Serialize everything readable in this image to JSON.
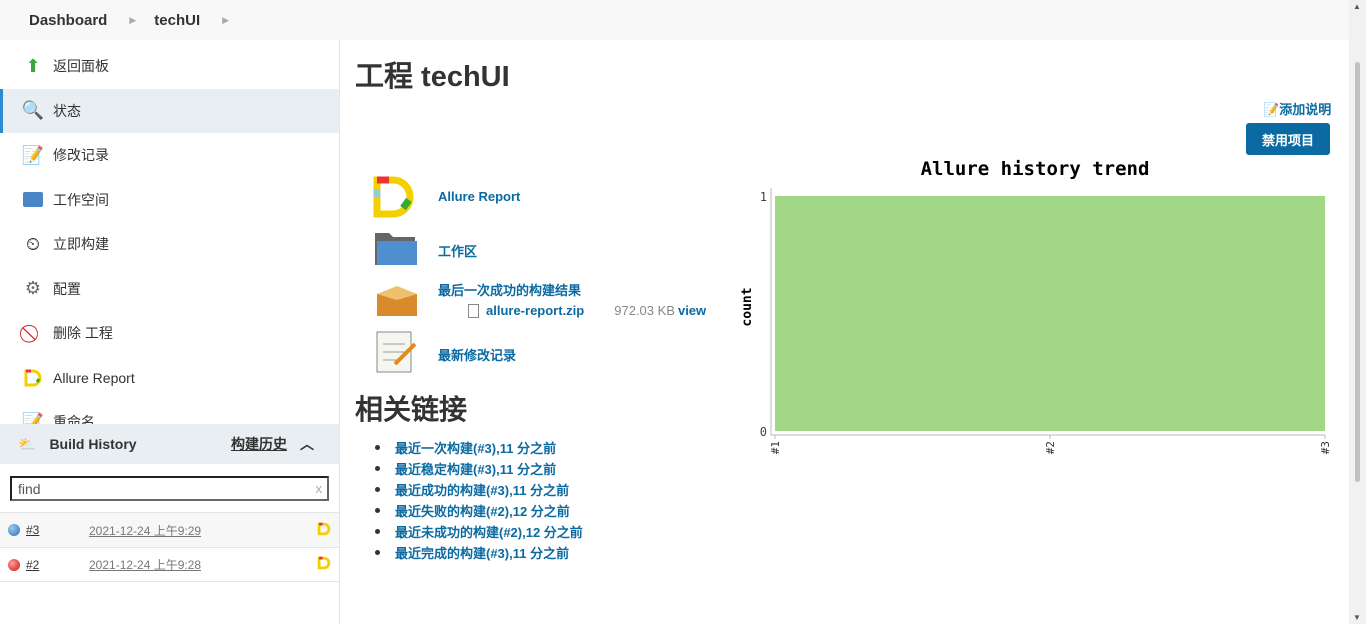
{
  "breadcrumb": [
    "Dashboard",
    "techUI"
  ],
  "sidebar": {
    "items": [
      {
        "label": "返回面板",
        "icon": "up-arrow-icon"
      },
      {
        "label": "状态",
        "icon": "search-icon",
        "active": true
      },
      {
        "label": "修改记录",
        "icon": "notepad-icon"
      },
      {
        "label": "工作空间",
        "icon": "folder-icon"
      },
      {
        "label": "立即构建",
        "icon": "clock-build-icon"
      },
      {
        "label": "配置",
        "icon": "gear-icon"
      },
      {
        "label": "删除 工程",
        "icon": "no-entry-icon"
      },
      {
        "label": "Allure Report",
        "icon": "allure-icon"
      },
      {
        "label": "重命名",
        "icon": "notepad-icon"
      }
    ]
  },
  "build_history": {
    "title": "Build History",
    "trend_label": "构建历史",
    "search_placeholder": "find",
    "clear": "x",
    "builds": [
      {
        "number": "#3",
        "date": "2021-12-24 上午9:29",
        "status": "blue",
        "status_color": "#2a6fb8"
      },
      {
        "number": "#2",
        "date": "2021-12-24 上午9:28",
        "status": "red",
        "status_color": "#e02020"
      }
    ]
  },
  "main": {
    "title": "工程 techUI",
    "add_description": "添加说明",
    "disable_button": "禁用项目",
    "links": [
      {
        "label": "Allure Report",
        "icon": "allure-icon"
      },
      {
        "label": "工作区",
        "icon": "folder-icon"
      },
      {
        "label": "最后一次成功的构建结果",
        "icon": "package-icon"
      },
      {
        "label": "最新修改记录",
        "icon": "notepad-icon"
      }
    ],
    "artifact": {
      "name": "allure-report.zip",
      "size": "972.03 KB",
      "view": "view"
    },
    "related_title": "相关链接",
    "related": [
      "最近一次构建(#3),11 分之前",
      "最近稳定构建(#3),11 分之前",
      "最近成功的构建(#3),11 分之前",
      "最近失败的构建(#2),12 分之前",
      "最近未成功的构建(#2),12 分之前",
      "最近完成的构建(#3),11 分之前"
    ]
  },
  "chart_data": {
    "type": "area",
    "title": "Allure history trend",
    "xlabel": "",
    "ylabel": "count",
    "categories": [
      "#1",
      "#2",
      "#3"
    ],
    "series": [
      {
        "values": [
          1,
          1,
          1
        ],
        "color": "#a1d787"
      }
    ],
    "ylim": [
      0,
      1
    ],
    "yticks": [
      0,
      1
    ],
    "grid": false,
    "legend": "none"
  }
}
